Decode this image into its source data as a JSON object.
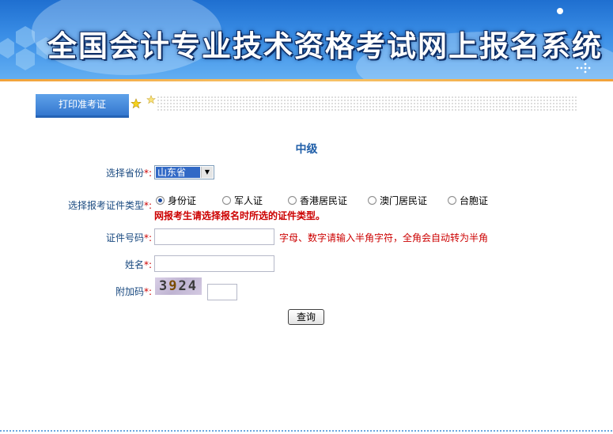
{
  "banner": {
    "title": "全国会计专业技术资格考试网上报名系统"
  },
  "tab": {
    "label": "打印准考证"
  },
  "form": {
    "level": "中级",
    "province_label": "选择省份",
    "province_value": "山东省",
    "idtype_label": "选择报考证件类型",
    "idtype_options": [
      "身份证",
      "军人证",
      "香港居民证",
      "澳门居民证",
      "台胞证"
    ],
    "idtype_selected": "身份证",
    "idtype_warning": "网报考生请选择报名时所选的证件类型。",
    "idnumber_label": "证件号码",
    "idnumber_value": "",
    "idnumber_hint": "字母、数字请输入半角字符，全角会自动转为半角",
    "name_label": "姓名",
    "name_value": "",
    "captcha_label": "附加码",
    "captcha_digits": [
      "3",
      "9",
      "2",
      "4"
    ],
    "captcha_value": "",
    "required_mark": "*:",
    "query_button": "查询"
  }
}
